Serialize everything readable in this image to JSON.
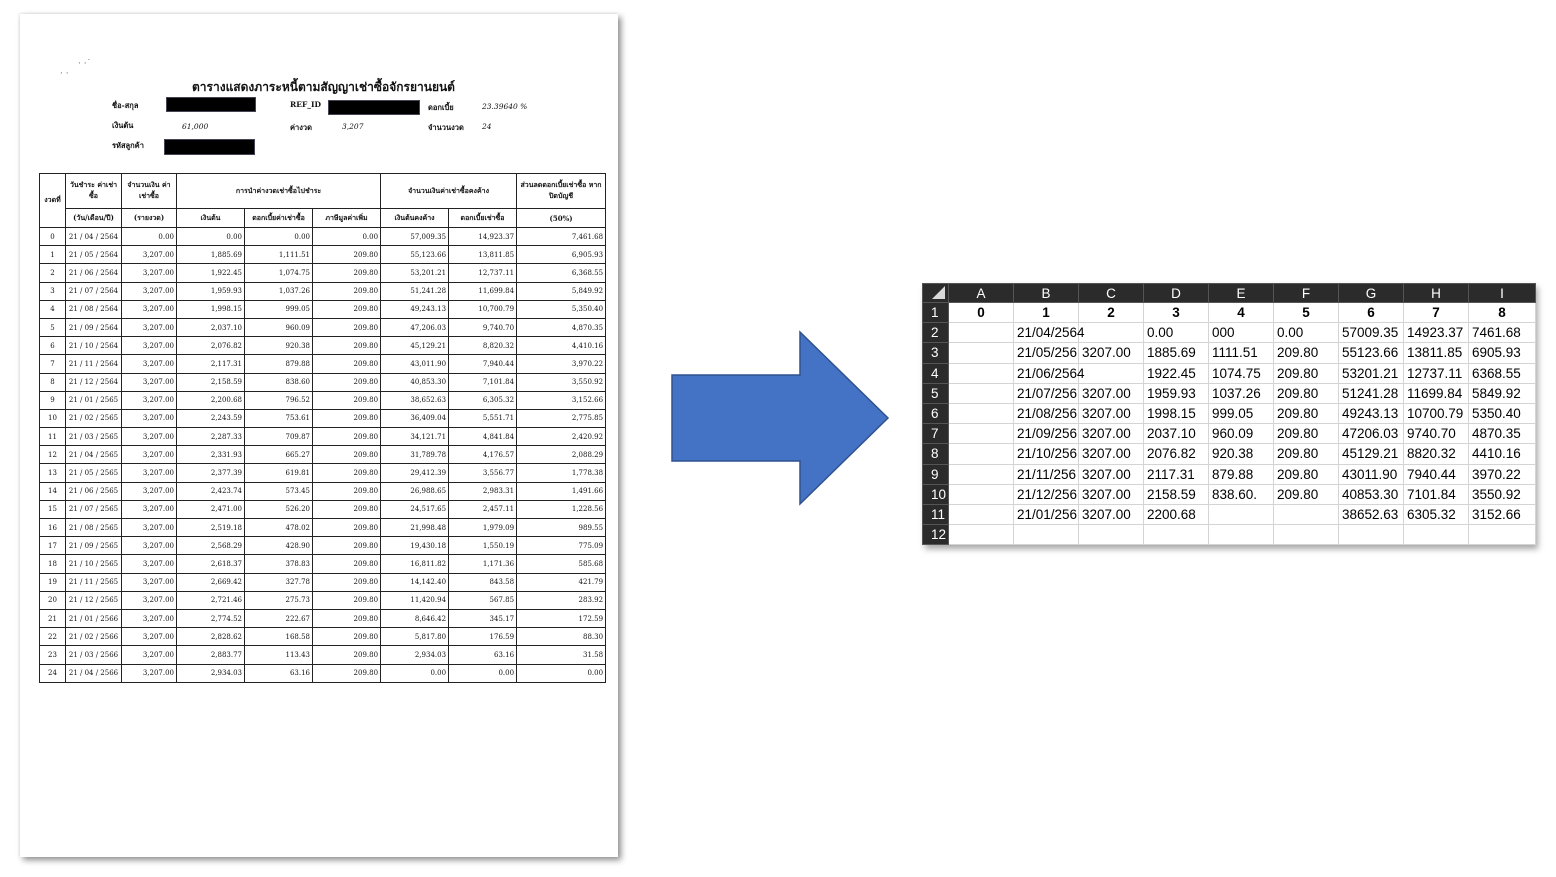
{
  "document": {
    "title": "ตารางแสดงภาระหนี้ตามสัญญาเช่าซื้อจักรยานยนต์",
    "fields": {
      "name_label": "ชื่อ-สกุล",
      "ref_label": "REF_ID",
      "interest_label": "ดอกเบี้ย",
      "interest_value": "23.39640 %",
      "principal_label": "เงินต้น",
      "principal_value": "61,000",
      "installment_label": "ค่างวด",
      "installment_value": "3,207",
      "periods_label": "จำนวนงวด",
      "periods_value": "24",
      "customer_label": "รหัสลูกค้า"
    },
    "headers": {
      "period": "งวดที่",
      "due_date": "วันชำระ ค่าเช่าซื้อ",
      "due_date_sub": "(วัน/เดือน/ปี)",
      "amount": "จำนวนเงิน ค่าเช่าซื้อ",
      "amount_sub": "(รายงวด)",
      "allocation": "การนำค่างวดเช่าซื้อไปชำระ",
      "principal": "เงินต้น",
      "interest": "ดอกเบี้ยค่าเช่าซื้อ",
      "vat": "ภาษีมูลค่าเพิ่ม",
      "outstanding": "จำนวนเงินค่าเช่าซื้อคงค้าง",
      "outstanding_principal": "เงินต้นคงค้าง",
      "outstanding_interest": "ดอกเบี้ยเช่าซื้อ",
      "discount": "ส่วนลดดอกเบี้ยเช่าซื้อ หากปิดบัญชี",
      "discount_sub": "(50%)"
    },
    "rows": [
      [
        "0",
        "21 / 04 / 2564",
        "0.00",
        "0.00",
        "0.00",
        "0.00",
        "57,009.35",
        "14,923.37",
        "7,461.68"
      ],
      [
        "1",
        "21 / 05 / 2564",
        "3,207.00",
        "1,885.69",
        "1,111.51",
        "209.80",
        "55,123.66",
        "13,811.85",
        "6,905.93"
      ],
      [
        "2",
        "21 / 06 / 2564",
        "3,207.00",
        "1,922.45",
        "1,074.75",
        "209.80",
        "53,201.21",
        "12,737.11",
        "6,368.55"
      ],
      [
        "3",
        "21 / 07 / 2564",
        "3,207.00",
        "1,959.93",
        "1,037.26",
        "209.80",
        "51,241.28",
        "11,699.84",
        "5,849.92"
      ],
      [
        "4",
        "21 / 08 / 2564",
        "3,207.00",
        "1,998.15",
        "999.05",
        "209.80",
        "49,243.13",
        "10,700.79",
        "5,350.40"
      ],
      [
        "5",
        "21 / 09 / 2564",
        "3,207.00",
        "2,037.10",
        "960.09",
        "209.80",
        "47,206.03",
        "9,740.70",
        "4,870.35"
      ],
      [
        "6",
        "21 / 10 / 2564",
        "3,207.00",
        "2,076.82",
        "920.38",
        "209.80",
        "45,129.21",
        "8,820.32",
        "4,410.16"
      ],
      [
        "7",
        "21 / 11 / 2564",
        "3,207.00",
        "2,117.31",
        "879.88",
        "209.80",
        "43,011.90",
        "7,940.44",
        "3,970.22"
      ],
      [
        "8",
        "21 / 12 / 2564",
        "3,207.00",
        "2,158.59",
        "838.60",
        "209.80",
        "40,853.30",
        "7,101.84",
        "3,550.92"
      ],
      [
        "9",
        "21 / 01 / 2565",
        "3,207.00",
        "2,200.68",
        "796.52",
        "209.80",
        "38,652.63",
        "6,305.32",
        "3,152.66"
      ],
      [
        "10",
        "21 / 02 / 2565",
        "3,207.00",
        "2,243.59",
        "753.61",
        "209.80",
        "36,409.04",
        "5,551.71",
        "2,775.85"
      ],
      [
        "11",
        "21 / 03 / 2565",
        "3,207.00",
        "2,287.33",
        "709.87",
        "209.80",
        "34,121.71",
        "4,841.84",
        "2,420.92"
      ],
      [
        "12",
        "21 / 04 / 2565",
        "3,207.00",
        "2,331.93",
        "665.27",
        "209.80",
        "31,789.78",
        "4,176.57",
        "2,088.29"
      ],
      [
        "13",
        "21 / 05 / 2565",
        "3,207.00",
        "2,377.39",
        "619.81",
        "209.80",
        "29,412.39",
        "3,556.77",
        "1,778.38"
      ],
      [
        "14",
        "21 / 06 / 2565",
        "3,207.00",
        "2,423.74",
        "573.45",
        "209.80",
        "26,988.65",
        "2,983.31",
        "1,491.66"
      ],
      [
        "15",
        "21 / 07 / 2565",
        "3,207.00",
        "2,471.00",
        "526.20",
        "209.80",
        "24,517.65",
        "2,457.11",
        "1,228.56"
      ],
      [
        "16",
        "21 / 08 / 2565",
        "3,207.00",
        "2,519.18",
        "478.02",
        "209.80",
        "21,998.48",
        "1,979.09",
        "989.55"
      ],
      [
        "17",
        "21 / 09 / 2565",
        "3,207.00",
        "2,568.29",
        "428.90",
        "209.80",
        "19,430.18",
        "1,550.19",
        "775.09"
      ],
      [
        "18",
        "21 / 10 / 2565",
        "3,207.00",
        "2,618.37",
        "378.83",
        "209.80",
        "16,811.82",
        "1,171.36",
        "585.68"
      ],
      [
        "19",
        "21 / 11 / 2565",
        "3,207.00",
        "2,669.42",
        "327.78",
        "209.80",
        "14,142.40",
        "843.58",
        "421.79"
      ],
      [
        "20",
        "21 / 12 / 2565",
        "3,207.00",
        "2,721.46",
        "275.73",
        "209.80",
        "11,420.94",
        "567.85",
        "283.92"
      ],
      [
        "21",
        "21 / 01 / 2566",
        "3,207.00",
        "2,774.52",
        "222.67",
        "209.80",
        "8,646.42",
        "345.17",
        "172.59"
      ],
      [
        "22",
        "21 / 02 / 2566",
        "3,207.00",
        "2,828.62",
        "168.58",
        "209.80",
        "5,817.80",
        "176.59",
        "88.30"
      ],
      [
        "23",
        "21 / 03 / 2566",
        "3,207.00",
        "2,883.77",
        "113.43",
        "209.80",
        "2,934.03",
        "63.16",
        "31.58"
      ],
      [
        "24",
        "21 / 04 / 2566",
        "3,207.00",
        "2,934.03",
        "63.16",
        "209.80",
        "0.00",
        "0.00",
        "0.00"
      ]
    ]
  },
  "spreadsheet": {
    "columns": [
      "A",
      "B",
      "C",
      "D",
      "E",
      "F",
      "G",
      "H",
      "I"
    ],
    "row_numbers": [
      "1",
      "2",
      "3",
      "4",
      "5",
      "6",
      "7",
      "8",
      "9",
      "10",
      "11",
      "12"
    ],
    "rows": [
      [
        "0",
        "1",
        "2",
        "3",
        "4",
        "5",
        "6",
        "7",
        "8"
      ],
      [
        "",
        "21/04/2564",
        "",
        "0.00",
        "000",
        "0.00",
        "57009.35",
        "14923.37",
        "7461.68"
      ],
      [
        "",
        "21/05/256",
        "3207.00",
        "1885.69",
        "1111.51",
        "209.80",
        "55123.66",
        "13811.85",
        "6905.93"
      ],
      [
        "",
        "21/06/2564",
        "",
        "1922.45",
        "1074.75",
        "209.80",
        "53201.21",
        "12737.11",
        "6368.55"
      ],
      [
        "",
        "21/07/256",
        "3207.00",
        "1959.93",
        "1037.26",
        "209.80",
        "51241.28",
        "11699.84",
        "5849.92"
      ],
      [
        "",
        "21/08/256",
        "3207.00",
        "1998.15",
        "999.05",
        "209.80",
        "49243.13",
        "10700.79",
        "5350.40"
      ],
      [
        "",
        "21/09/256",
        "3207.00",
        "2037.10",
        "960.09",
        "209.80",
        "47206.03",
        "9740.70",
        "4870.35"
      ],
      [
        "",
        "21/10/256",
        "3207.00",
        "2076.82",
        "920.38",
        "209.80",
        "45129.21",
        "8820.32",
        "4410.16"
      ],
      [
        "",
        "21/11/256",
        "3207.00",
        "2117.31",
        "879.88",
        "209.80",
        "43011.90",
        "7940.44",
        "3970.22"
      ],
      [
        "",
        "21/12/256",
        "3207.00",
        "2158.59",
        "838.60.",
        "209.80",
        "40853.30",
        "7101.84",
        "3550.92"
      ],
      [
        "",
        "21/01/256",
        "3207.00",
        "2200.68",
        "",
        "",
        "38652.63",
        "6305.32",
        "3152.66"
      ],
      [
        "",
        "",
        "",
        "",
        "",
        "",
        "",
        "",
        ""
      ]
    ]
  },
  "colors": {
    "arrow_fill": "#4472C4",
    "arrow_stroke": "#2F528F",
    "header_bg": "#2B2B2B",
    "grid": "#D4D4D4"
  }
}
